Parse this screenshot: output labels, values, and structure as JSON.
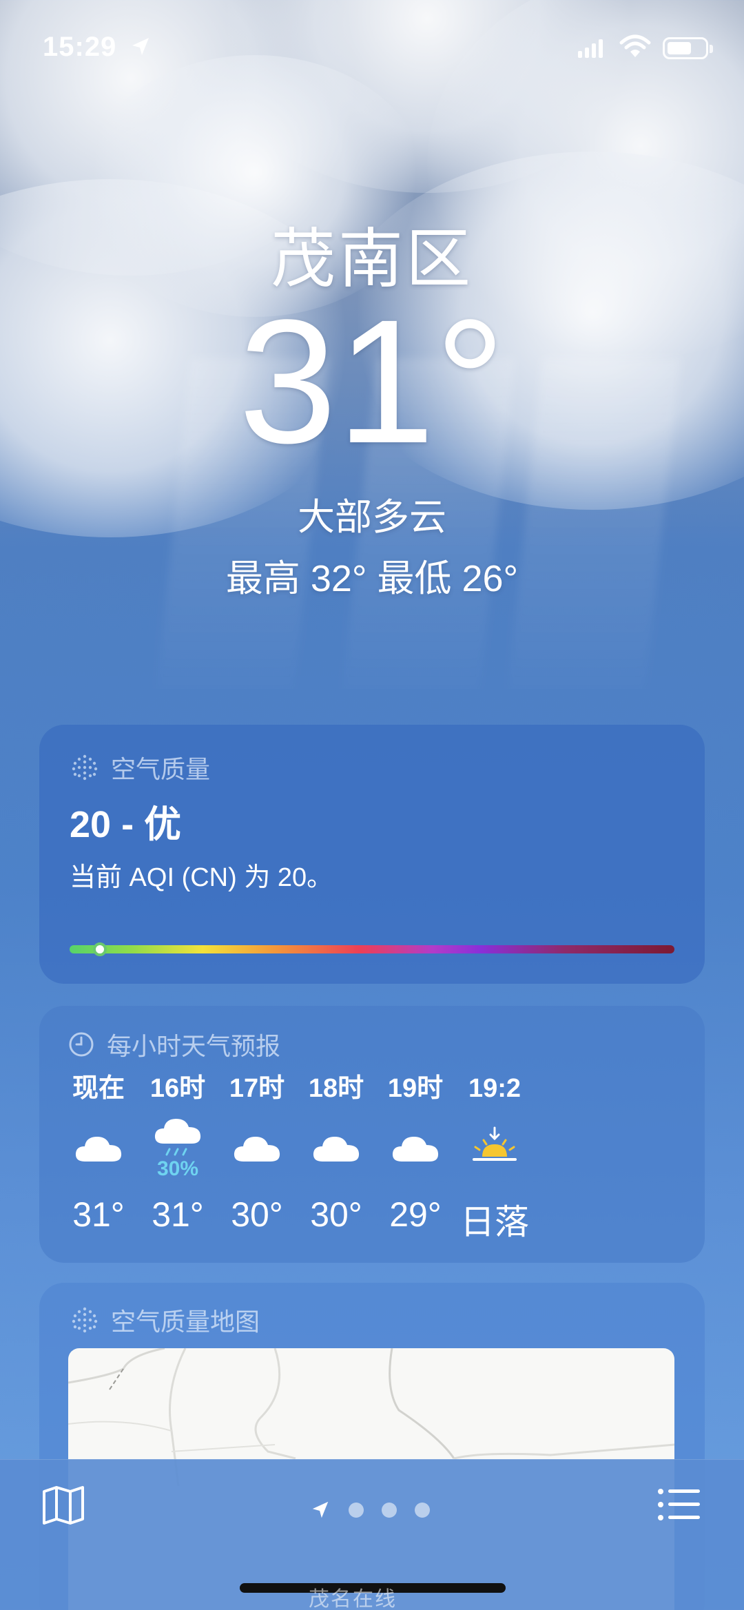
{
  "status_bar": {
    "time": "15:29"
  },
  "hero": {
    "city": "茂南区",
    "temperature": "31°",
    "condition": "大部多云",
    "high_low": "最高 32°  最低 26°"
  },
  "air_quality": {
    "header": "空气质量",
    "value": "20 - 优",
    "description": "当前 AQI (CN) 为 20。",
    "level_fraction": 0.05
  },
  "hourly": {
    "header": "每小时天气预报",
    "items": [
      {
        "label": "现在",
        "icon": "cloud-icon",
        "temp": "31°",
        "precip": ""
      },
      {
        "label": "16时",
        "icon": "cloud-rain-icon",
        "temp": "31°",
        "precip": "30%"
      },
      {
        "label": "17时",
        "icon": "cloud-icon",
        "temp": "30°",
        "precip": ""
      },
      {
        "label": "18时",
        "icon": "cloud-icon",
        "temp": "30°",
        "precip": ""
      },
      {
        "label": "19时",
        "icon": "cloud-icon",
        "temp": "29°",
        "precip": ""
      },
      {
        "label": "19:2",
        "icon": "sunset-icon",
        "temp": "日落",
        "precip": ""
      }
    ]
  },
  "air_map": {
    "header": "空气质量地图"
  },
  "toolbar": {
    "page_dots": 3
  },
  "watermark": "茂名在线"
}
